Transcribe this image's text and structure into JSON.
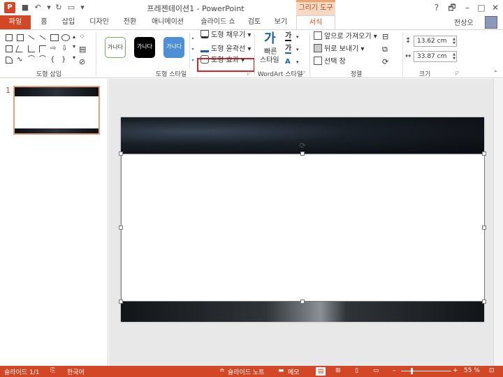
{
  "titlebar": {
    "app_icon": "P",
    "title": "프레젠테이션1 - PowerPoint",
    "context_tab_group": "그리기 도구",
    "help_icon": "?",
    "window_buttons": [
      "🗗",
      "–",
      "□",
      "✕"
    ]
  },
  "tabs": {
    "file": "파일",
    "items": [
      "홈",
      "삽입",
      "디자인",
      "전환",
      "애니메이션",
      "슬라이드 쇼",
      "검토",
      "보기"
    ],
    "format": "서식",
    "user": "전상오"
  },
  "ribbon": {
    "groups": {
      "insert_shapes": "도형 삽입",
      "shape_styles": "도형 스타일",
      "wordart_styles": "WordArt 스타일",
      "arrange": "정렬",
      "size": "크기"
    },
    "style_swatches": [
      "가나다",
      "가나다",
      "가나다"
    ],
    "shape_fill": "도형 채우기",
    "shape_outline": "도형 윤곽선",
    "shape_effects": "도형 효과",
    "quick_styles_line1": "빠른",
    "quick_styles_line2": "스타일",
    "bring_forward": "앞으로 가져오기",
    "send_backward": "뒤로 보내기",
    "selection_pane": "선택 창",
    "height": "13.62 cm",
    "width": "33.87 cm",
    "colors": {
      "accent": "#d24726",
      "highlight": "#e02020"
    }
  },
  "thumbs": {
    "number": "1"
  },
  "statusbar": {
    "slide_info": "슬라이드 1/1",
    "language": "한국어",
    "notes": "슬라이드 노트",
    "comments": "메모",
    "zoom": "55 %",
    "zoom_minus": "–",
    "zoom_plus": "+"
  }
}
